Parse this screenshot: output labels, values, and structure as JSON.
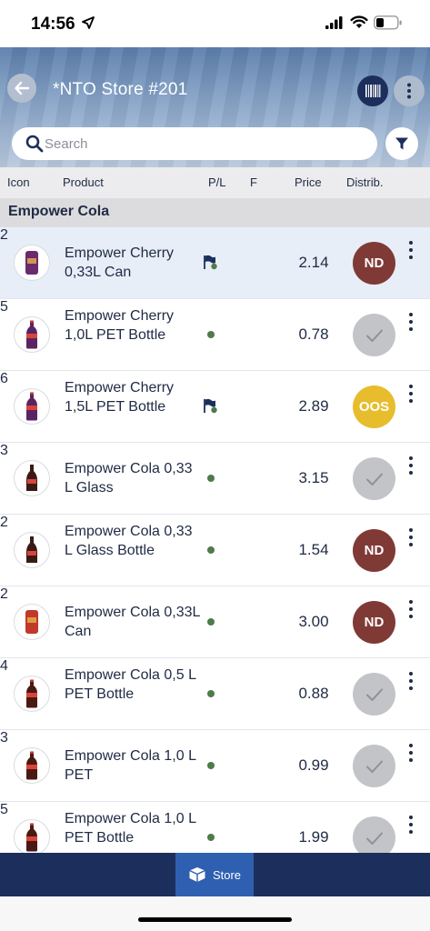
{
  "status": {
    "time": "14:56"
  },
  "header": {
    "title": "*NTO Store #201"
  },
  "search": {
    "placeholder": "Search"
  },
  "columns": {
    "icon": "Icon",
    "product": "Product",
    "pl": "P/L",
    "f": "F",
    "price": "Price",
    "distrib": "Distrib."
  },
  "group": {
    "name": "Empower Cola"
  },
  "products": [
    {
      "name": "Empower Cherry 0,33L Can",
      "pl": "flag",
      "facings": "2",
      "price": "2.14",
      "distrib": "ND",
      "status": "nd",
      "pack": "can",
      "color": "#6b2a6b",
      "selected": true
    },
    {
      "name": "Empower Cherry 1,0L PET Bottle",
      "pl": "dot",
      "facings": "5",
      "price": "0.78",
      "distrib": "",
      "status": "ok",
      "pack": "bottle",
      "color": "#5a2463"
    },
    {
      "name": "Empower Cherry 1,5L PET Bottle",
      "pl": "flag",
      "facings": "6",
      "price": "2.89",
      "distrib": "OOS",
      "status": "oos",
      "pack": "bottle",
      "color": "#5a2463"
    },
    {
      "name": "Empower Cola 0,33 L Glass",
      "pl": "dot",
      "facings": "3",
      "price": "3.15",
      "distrib": "",
      "status": "ok",
      "pack": "glass",
      "color": "#3a1a14"
    },
    {
      "name": "Empower Cola 0,33 L Glass Bottle",
      "pl": "dot",
      "facings": "2",
      "price": "1.54",
      "distrib": "ND",
      "status": "nd",
      "pack": "glass",
      "color": "#3a1a14"
    },
    {
      "name": "Empower Cola 0,33L Can",
      "pl": "dot",
      "facings": "2",
      "price": "3.00",
      "distrib": "ND",
      "status": "nd",
      "pack": "can",
      "color": "#c0392b"
    },
    {
      "name": "Empower Cola 0,5 L PET Bottle",
      "pl": "dot",
      "facings": "4",
      "price": "0.88",
      "distrib": "",
      "status": "ok",
      "pack": "bottle",
      "color": "#4a1a12"
    },
    {
      "name": "Empower Cola 1,0 L PET",
      "pl": "dot",
      "facings": "3",
      "price": "0.99",
      "distrib": "",
      "status": "ok",
      "pack": "bottle",
      "color": "#4a1a12"
    },
    {
      "name": "Empower Cola 1,0 L PET Bottle",
      "pl": "dot",
      "facings": "5",
      "price": "1.99",
      "distrib": "",
      "status": "ok",
      "pack": "bottle",
      "color": "#4a1a12"
    }
  ],
  "bottom_nav": {
    "store_label": "Store"
  },
  "icons": [
    "location-arrow-icon",
    "signal-icon",
    "wifi-icon",
    "battery-icon",
    "back-arrow-icon",
    "barcode-icon",
    "more-vertical-icon",
    "search-icon",
    "filter-icon",
    "store-box-icon",
    "checkmark-icon",
    "flag-icon"
  ]
}
